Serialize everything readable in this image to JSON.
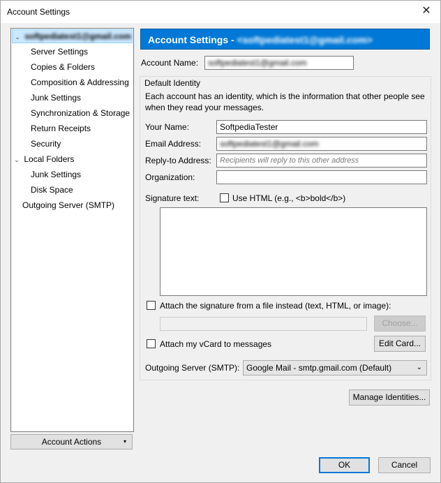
{
  "window": {
    "title": "Account Settings",
    "close_glyph": "✕"
  },
  "tree": {
    "account": "softpediatest1@gmail.com",
    "items": [
      "Server Settings",
      "Copies & Folders",
      "Composition & Addressing",
      "Junk Settings",
      "Synchronization & Storage",
      "Return Receipts",
      "Security"
    ],
    "local_folders": "Local Folders",
    "local_items": [
      "Junk Settings",
      "Disk Space"
    ],
    "outgoing": "Outgoing Server (SMTP)"
  },
  "account_actions": {
    "label": "Account Actions",
    "arrow": "▾"
  },
  "header": {
    "prefix": "Account Settings - ",
    "account": "<softpediatest1@gmail.com>"
  },
  "form": {
    "account_name_label": "Account Name:",
    "account_name_value": "softpediatest1@gmail.com",
    "identity_title": "Default Identity",
    "identity_desc": "Each account has an identity, which is the information that other people see when they read your messages.",
    "your_name_label": "Your Name:",
    "your_name_value": "SoftpediaTester",
    "email_label": "Email Address:",
    "email_value": "softpediatest1@gmail.com",
    "reply_to_label": "Reply-to Address:",
    "reply_to_placeholder": "Recipients will reply to this other address",
    "organization_label": "Organization:",
    "organization_value": "",
    "signature_label": "Signature text:",
    "use_html_label": "Use HTML (e.g., <b>bold</b>)",
    "attach_sig_label": "Attach the signature from a file instead (text, HTML, or image):",
    "choose_label": "Choose...",
    "attach_vcard_label": "Attach my vCard to messages",
    "edit_card_label": "Edit Card...",
    "outgoing_label": "Outgoing Server (SMTP):",
    "outgoing_value": "Google Mail - smtp.gmail.com (Default)",
    "manage_identities_label": "Manage Identities..."
  },
  "footer": {
    "ok": "OK",
    "cancel": "Cancel"
  }
}
